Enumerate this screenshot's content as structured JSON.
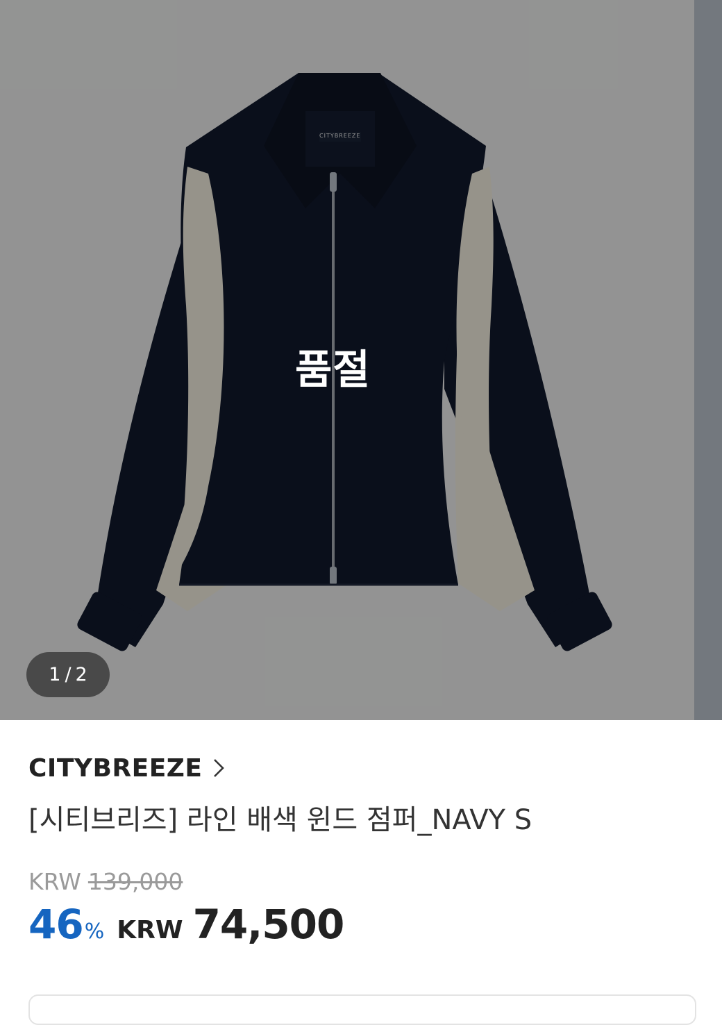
{
  "gallery": {
    "overlay_text": "품절",
    "pager_current": "1",
    "pager_separator": "/",
    "pager_total": "2",
    "tag_text": "CITYBREEZE"
  },
  "product": {
    "brand": "CITYBREEZE",
    "title": "[시티브리즈] 라인 배색 윈드 점퍼_NAVY S",
    "currency": "KRW",
    "original_price": "139,000",
    "discount_rate": "46",
    "discount_unit": "%",
    "sale_price": "74,500"
  },
  "colors": {
    "accent": "#1565c0",
    "jacket_navy": "#0e1424",
    "panel_beige": "#c9c4b8"
  }
}
